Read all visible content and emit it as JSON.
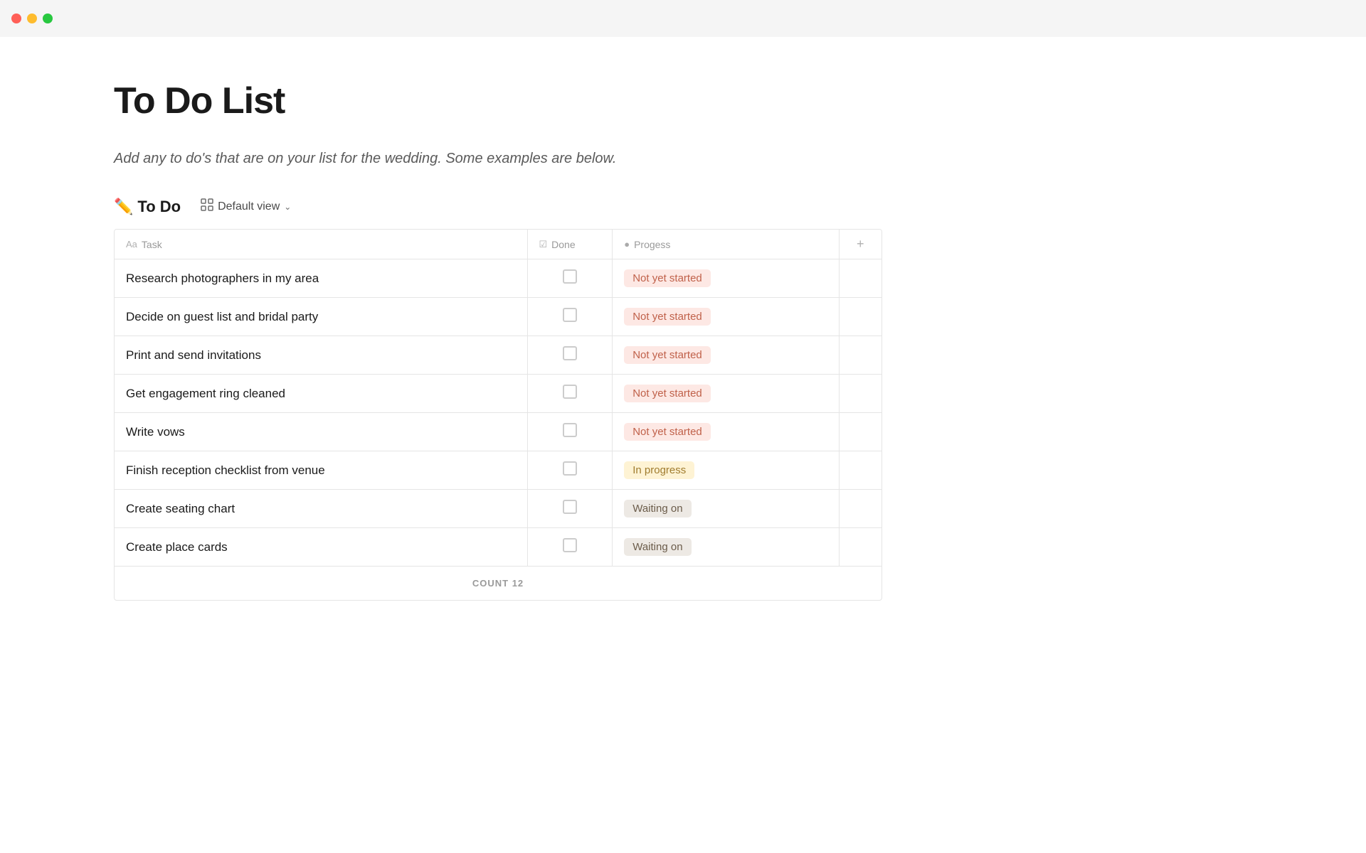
{
  "titlebar": {
    "close_label": "close",
    "minimize_label": "minimize",
    "maximize_label": "maximize"
  },
  "page": {
    "title": "To Do List",
    "description": "Add any to do's that are on your list for the wedding. Some examples are below.",
    "emoji": "✏️"
  },
  "database": {
    "title": "To Do",
    "emoji": "✏️",
    "view_label": "Default view",
    "chevron": "∨"
  },
  "table": {
    "columns": [
      {
        "id": "task",
        "label": "Task",
        "icon": "Aa"
      },
      {
        "id": "done",
        "label": "Done",
        "icon": "☑"
      },
      {
        "id": "progress",
        "label": "Progess",
        "icon": "◕"
      },
      {
        "id": "add",
        "label": "+",
        "icon": ""
      }
    ],
    "rows": [
      {
        "task": "Research photographers in my area",
        "done": false,
        "status": "Not yet started",
        "status_type": "not-started"
      },
      {
        "task": "Decide on guest list and bridal party",
        "done": false,
        "status": "Not yet started",
        "status_type": "not-started"
      },
      {
        "task": "Print and send invitations",
        "done": false,
        "status": "Not yet started",
        "status_type": "not-started"
      },
      {
        "task": "Get engagement ring cleaned",
        "done": false,
        "status": "Not yet started",
        "status_type": "not-started"
      },
      {
        "task": "Write vows",
        "done": false,
        "status": "Not yet started",
        "status_type": "not-started"
      },
      {
        "task": "Finish reception checklist from venue",
        "done": false,
        "status": "In progress",
        "status_type": "in-progress"
      },
      {
        "task": "Create seating chart",
        "done": false,
        "status": "Waiting on",
        "status_type": "waiting"
      },
      {
        "task": "Create place cards",
        "done": false,
        "status": "Waiting on",
        "status_type": "waiting"
      }
    ],
    "count_label": "COUNT",
    "count_value": "12"
  }
}
